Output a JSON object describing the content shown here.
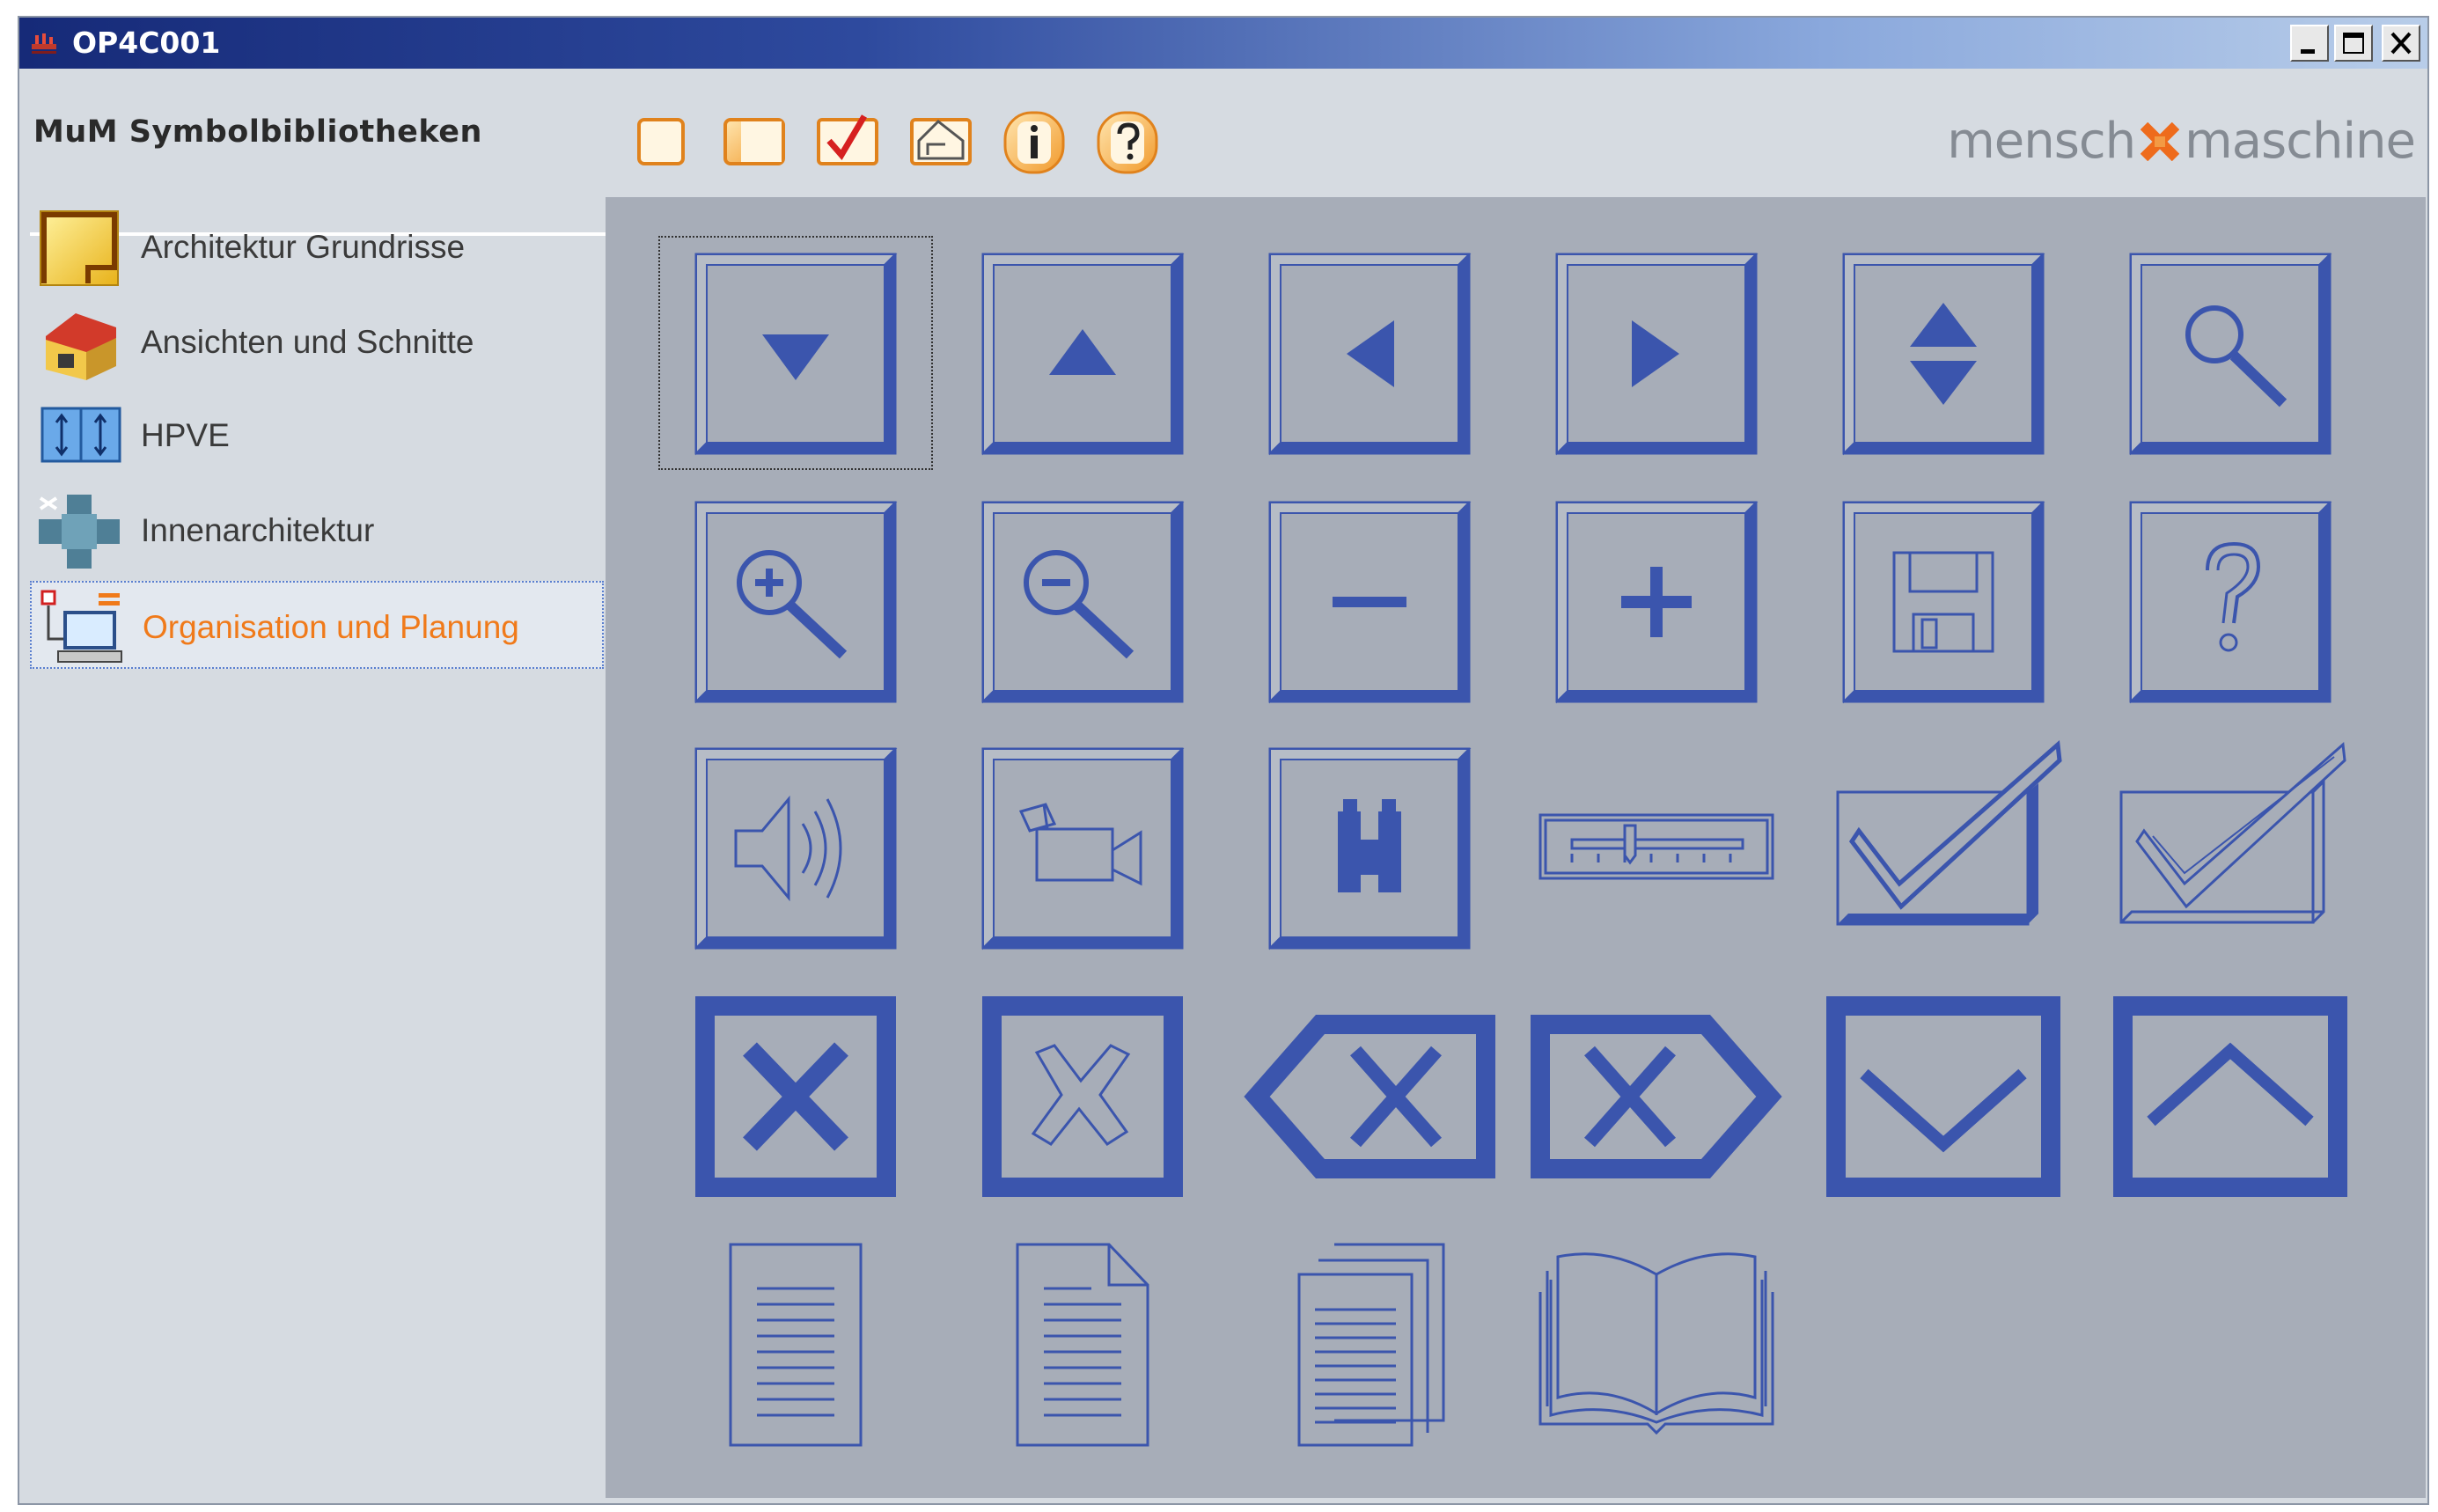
{
  "window": {
    "title": "OP4C001",
    "controls": [
      "minimize-icon",
      "maximize-icon",
      "close-icon"
    ]
  },
  "header": {
    "library_title": "MuM Symbolbibliotheken",
    "toolbar": [
      {
        "name": "new-page-icon"
      },
      {
        "name": "split-view-icon"
      },
      {
        "name": "checkmark-icon"
      },
      {
        "name": "house-plan-icon"
      },
      {
        "name": "info-icon"
      },
      {
        "name": "help-icon"
      }
    ],
    "logo": {
      "left": "mensch",
      "right": "maschine"
    }
  },
  "sidebar": {
    "items": [
      {
        "label": "Architektur Grundrisse",
        "icon": "floorplan-icon",
        "selected": false
      },
      {
        "label": "Ansichten und Schnitte",
        "icon": "house-icon",
        "selected": false
      },
      {
        "label": "HPVE",
        "icon": "hpve-icon",
        "selected": false
      },
      {
        "label": "Innenarchitektur",
        "icon": "interior-icon",
        "selected": false
      },
      {
        "label": "Organisation und Planung",
        "icon": "organisation-icon",
        "selected": true
      }
    ]
  },
  "symbols": [
    [
      "arrow-down-icon",
      "arrow-up-icon",
      "arrow-left-icon",
      "arrow-right-icon",
      "arrow-updown-icon",
      "magnifier-icon"
    ],
    [
      "zoom-in-icon",
      "zoom-out-icon",
      "minus-icon",
      "plus-icon",
      "floppy-disk-icon",
      "question-icon"
    ],
    [
      "speaker-icon",
      "video-camera-icon",
      "binoculars-icon",
      "slider-icon",
      "checkbox-checked-icon",
      "checkbox-checked-outline-icon"
    ],
    [
      "close-x-icon",
      "close-x-outline-icon",
      "backspace-icon",
      "delete-forward-icon",
      "chevron-down-icon",
      "chevron-up-icon"
    ],
    [
      "document-icon",
      "document-folded-icon",
      "documents-stack-icon",
      "book-icon"
    ]
  ],
  "colors": {
    "symbol_blue": "#3b55ad",
    "panel_gray": "#a7adb8",
    "accent_orange": "#f07a1a"
  }
}
